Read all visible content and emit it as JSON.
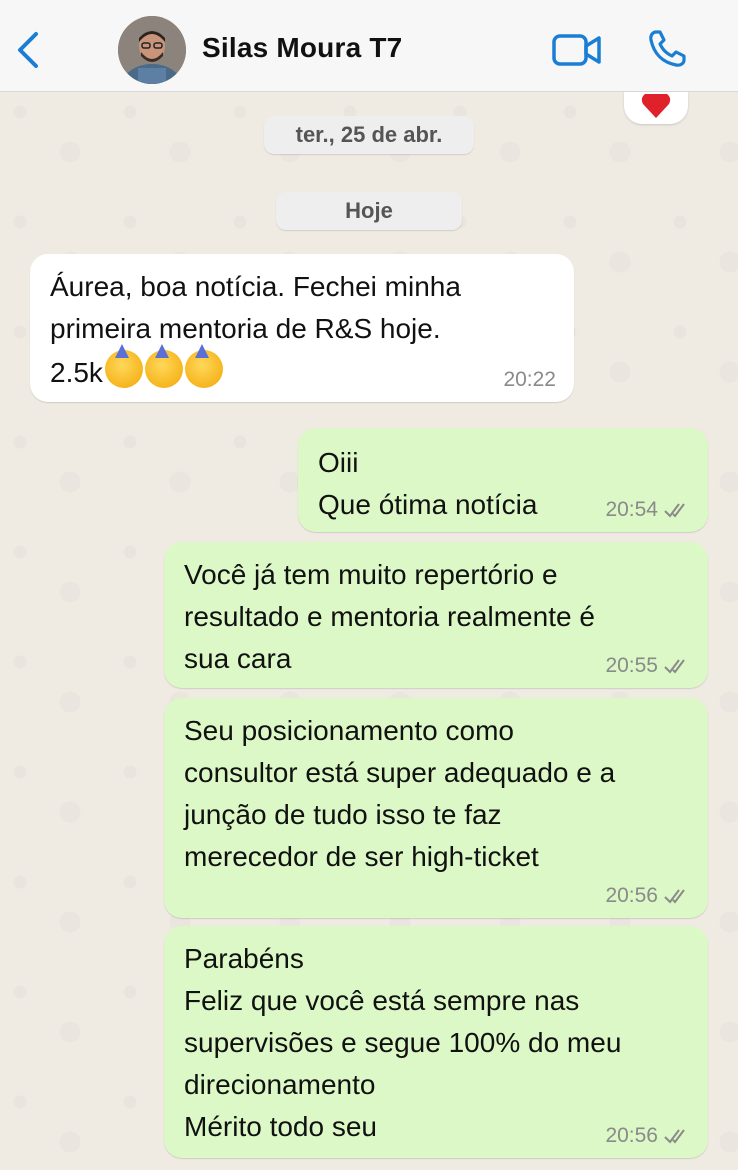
{
  "header": {
    "contact_name": "Silas Moura T7",
    "back_icon": "chevron-left-icon",
    "video_icon": "video-camera-icon",
    "call_icon": "phone-icon"
  },
  "reaction": {
    "emoji": "❤️",
    "icon": "heart-icon"
  },
  "dates": [
    "ter., 25 de abr.",
    "Hoje"
  ],
  "messages": [
    {
      "direction": "in",
      "text": "Áurea, boa notícia. Fechei minha\nprimeira mentoria de R&S hoje.\n2.5k",
      "emojis": "🥳🥳🥳",
      "time": "20:22"
    },
    {
      "direction": "out",
      "text": "Oiii\nQue ótima notícia",
      "time": "20:54",
      "status": "read"
    },
    {
      "direction": "out",
      "text": "Você já tem muito repertório e\nresultado e mentoria realmente é\nsua cara",
      "time": "20:55",
      "status": "read"
    },
    {
      "direction": "out",
      "text": "Seu posicionamento como\nconsultor está super adequado e a\njunção de tudo isso te faz\nmerecedor de ser high-ticket",
      "time": "20:56",
      "status": "read"
    },
    {
      "direction": "out",
      "text": "Parabéns\nFeliz que você está sempre nas\nsupervisões e segue 100% do meu\ndirecionamento\nMérito todo seu",
      "time": "20:56",
      "status": "read"
    }
  ],
  "colors": {
    "accent": "#1a7fd4",
    "incoming_bubble": "#ffffff",
    "outgoing_bubble": "#dcf8c6",
    "wallpaper": "#efeae2",
    "read_tick": "#8a8a8a",
    "heart": "#e0202b"
  }
}
